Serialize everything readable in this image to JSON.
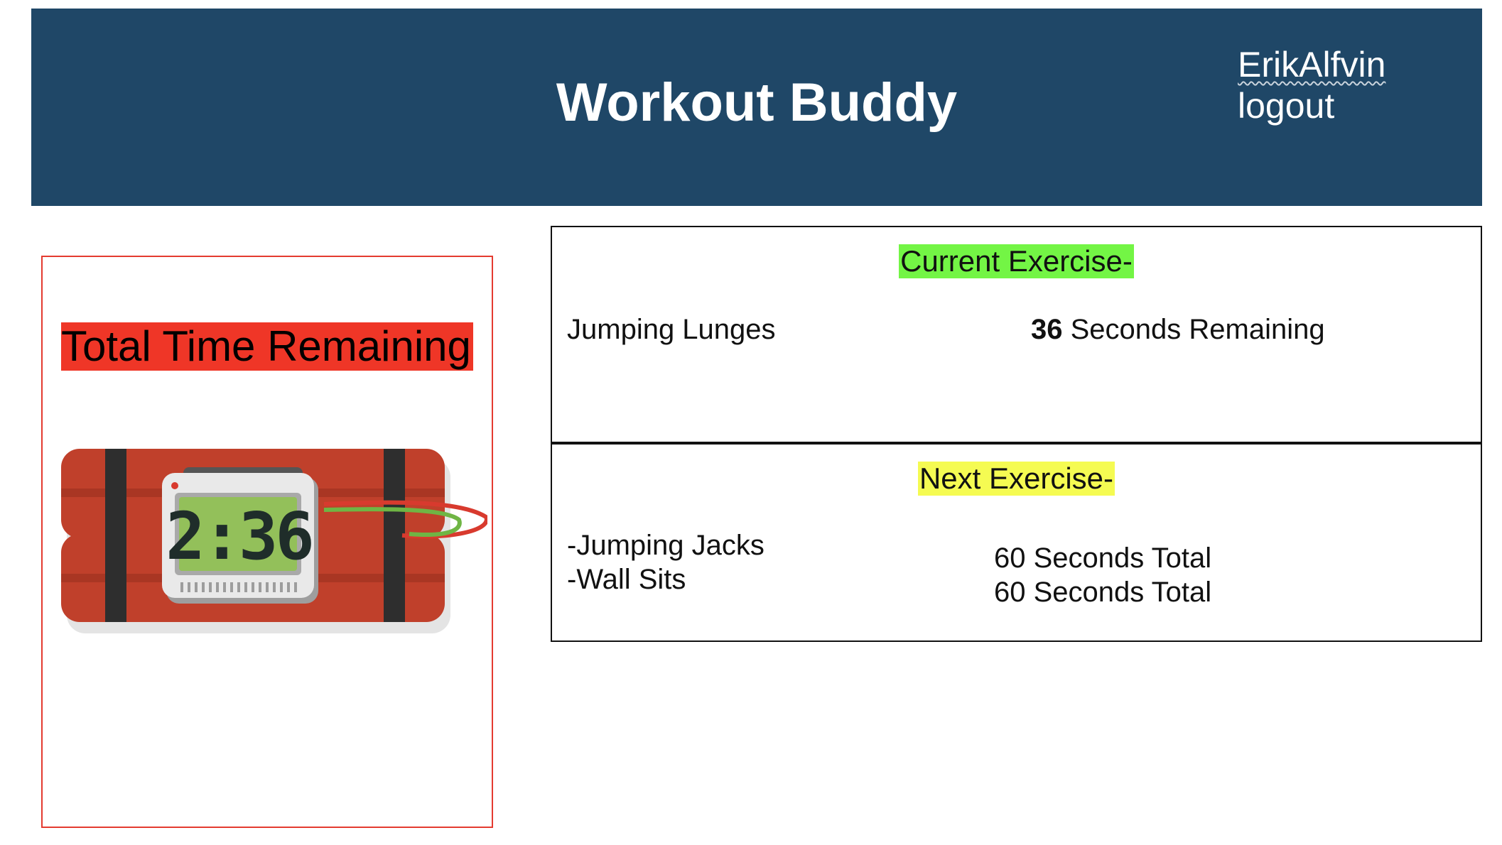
{
  "header": {
    "title": "Workout Buddy",
    "username": "ErikAlfvin",
    "logout_label": "logout"
  },
  "timer": {
    "label": "Total Time Remaining:",
    "display": "2:36"
  },
  "current_exercise": {
    "heading": "Current Exercise-",
    "name": "Jumping Lunges",
    "seconds": "36",
    "remaining_suffix": " Seconds Remaining"
  },
  "next_exercise": {
    "heading": "Next Exercise-",
    "items": [
      {
        "name": "-Jumping Jacks",
        "duration": "60 Seconds Total"
      },
      {
        "name": "-Wall Sits",
        "duration": "60 Seconds Total"
      }
    ]
  },
  "colors": {
    "header_bg": "#1f4767",
    "timer_label_bg": "#ef3627",
    "current_heading_bg": "#73f545",
    "next_heading_bg": "#f5fb52",
    "bomb_red": "#c0402b"
  },
  "icons": {
    "bomb": "dynamite-bomb-timer-icon"
  }
}
